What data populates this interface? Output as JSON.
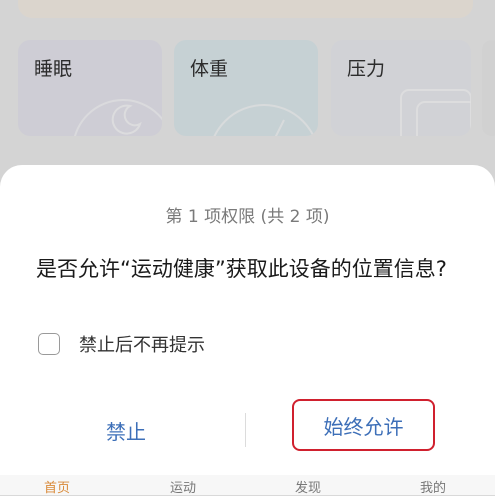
{
  "tiles": [
    {
      "label": "睡眠"
    },
    {
      "label": "体重"
    },
    {
      "label": "压力"
    }
  ],
  "dialog": {
    "step_text": "第 1 项权限 (共 2 项)",
    "message": "是否允许“运动健康”获取此设备的位置信息?",
    "checkbox_label": "禁止后不再提示",
    "checkbox_checked": false,
    "deny_label": "禁止",
    "allow_label": "始终允许"
  },
  "nav": {
    "items": [
      "首页",
      "运动",
      "发现",
      "我的"
    ],
    "active_index": 0
  },
  "colors": {
    "button_text": "#3d6fb8",
    "highlight_border": "#d0202e",
    "active_tab": "#d98a3a"
  }
}
